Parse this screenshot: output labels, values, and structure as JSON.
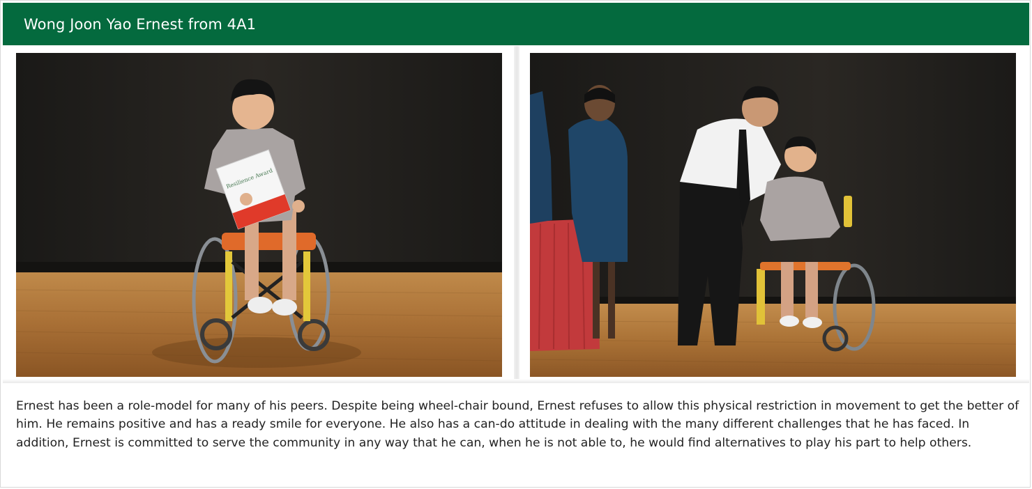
{
  "header": {
    "title": "Wong Joon Yao Ernest from 4A1"
  },
  "gallery": {
    "photos": [
      {
        "name": "photo-award-student",
        "certificate_text": "Resilience Award"
      },
      {
        "name": "photo-award-presentation"
      }
    ]
  },
  "description": "Ernest has been a role-model for many of his peers. Despite being wheel-chair bound, Ernest refuses to allow this physical restriction in movement to get the better of him. He remains positive and has a ready smile for everyone. He also has a can-do attitude in dealing with the many different challenges that he has faced. In addition, Ernest is committed to serve the community in any way that he can, when he is not able to, he would find alternatives to play his part to help others.",
  "colors": {
    "header_bg": "#046a3e",
    "header_text": "#ffffff",
    "stage_floor": "#b07a3e",
    "backdrop": "#1f1d1a"
  }
}
